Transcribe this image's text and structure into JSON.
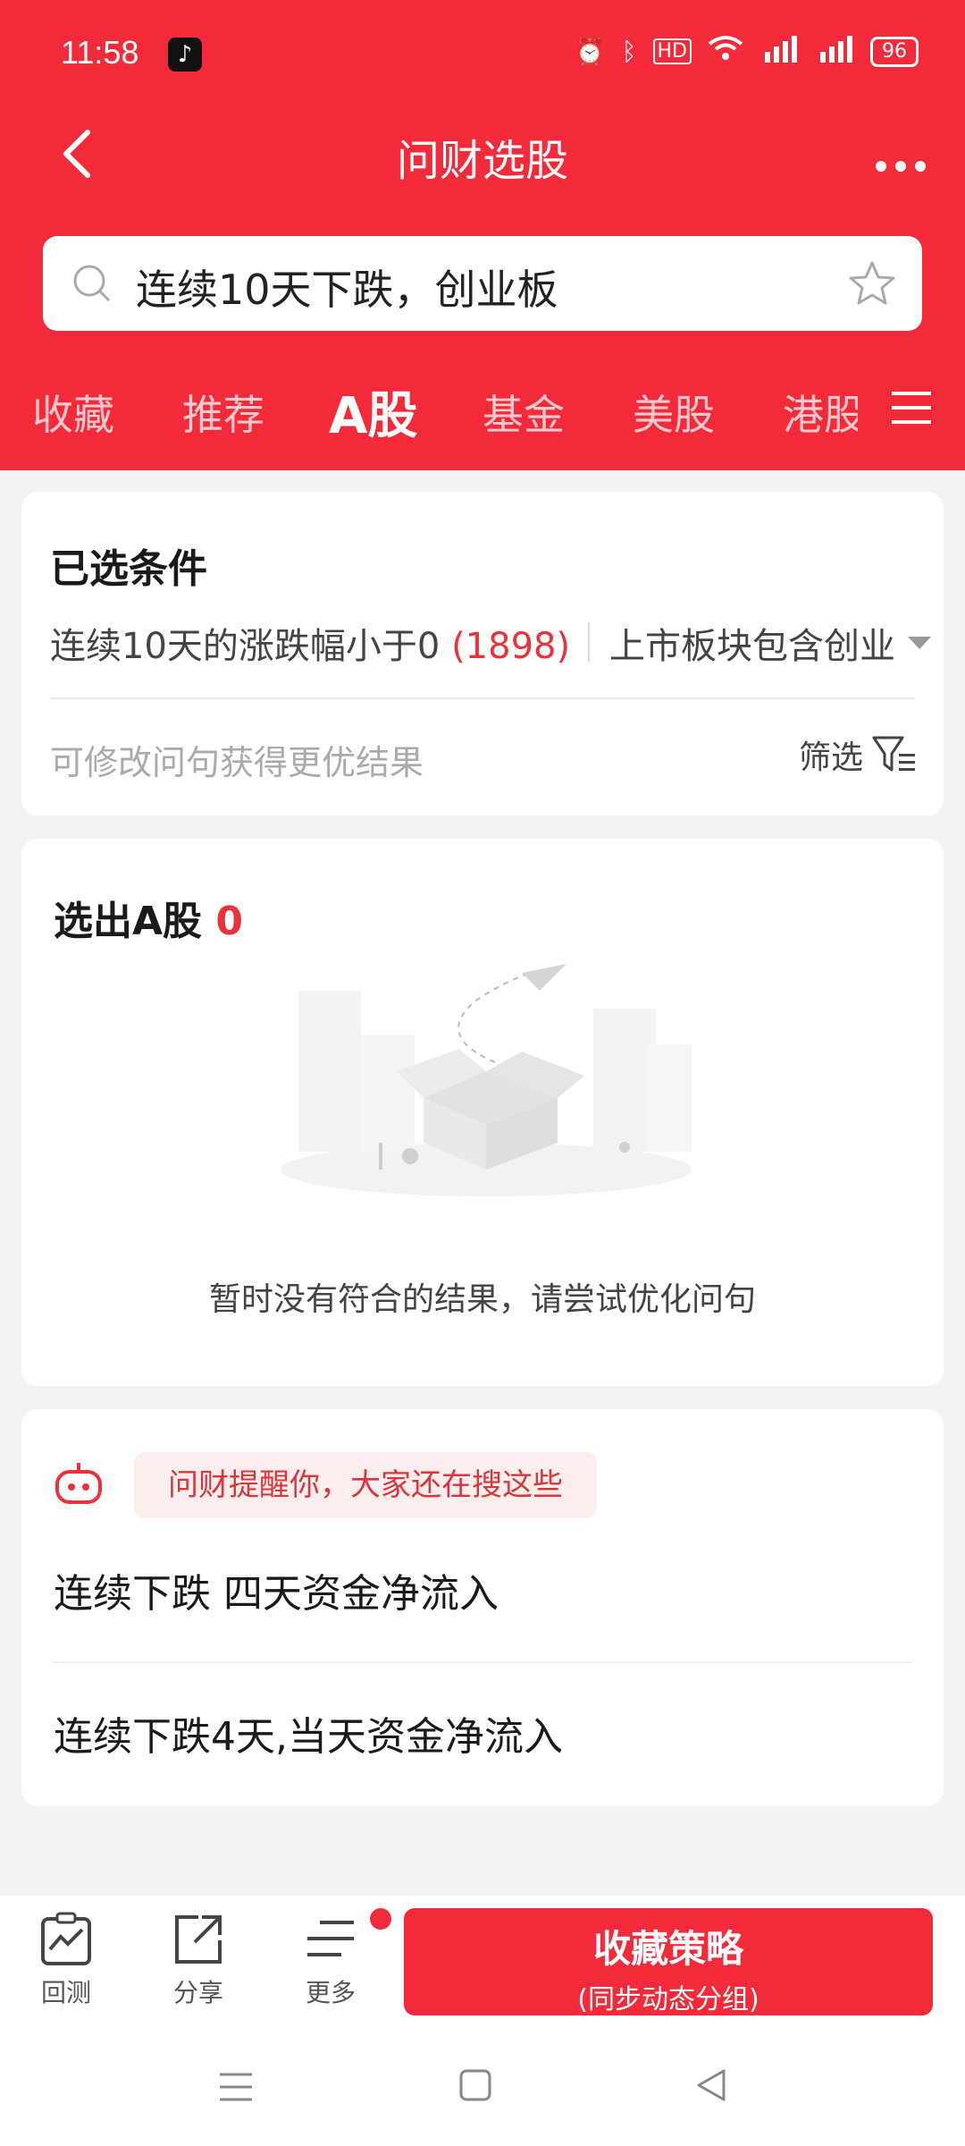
{
  "status_bar": {
    "time": "11:58",
    "battery": "96"
  },
  "header": {
    "title": "问财选股",
    "search_value": "连续10天下跌，创业板",
    "tabs": [
      "收藏",
      "推荐",
      "A股",
      "基金",
      "美股",
      "港股"
    ],
    "active_tab": "A股"
  },
  "conditions": {
    "title": "已选条件",
    "cond1_text": "连续10天的涨跌幅小于0 ",
    "cond1_count": "(1898)",
    "cond2_text": "上市板块包含创业",
    "hint": "可修改问句获得更优结果",
    "filter_label": "筛选"
  },
  "results": {
    "title": "选出A股",
    "count": "0",
    "empty_message": "暂时没有符合的结果，请尝试优化问句"
  },
  "suggestions": {
    "banner": "问财提醒你，大家还在搜这些",
    "items": [
      "连续下跌 四天资金净流入",
      "连续下跌4天,当天资金净流入"
    ]
  },
  "bottom_bar": {
    "backtest": "回测",
    "share": "分享",
    "more": "更多",
    "cta_main": "收藏策略",
    "cta_sub": "(同步动态分组)"
  },
  "colors": {
    "brand_red": "#f22a39",
    "count_red": "#e8323c"
  }
}
